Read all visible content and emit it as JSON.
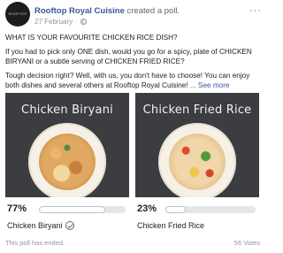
{
  "header": {
    "avatar_text": "ROOFTOP ROYAL",
    "page_name": "Rooftop Royal Cuisine",
    "action": "created a poll.",
    "date": "27 February"
  },
  "post": {
    "heading": "WHAT IS YOUR FAVOURITE CHICKEN RICE DISH?",
    "body": "If you had to pick only ONE dish, would you go for a spicy, plate of CHICKEN BIRYANI or a subtle serving of CHICKEN FRIED RICE?",
    "teaser": "Tough decision right? Well, with us, you don't have to choose! You can enjoy both dishes and several others at Rooftop Royal Cuisine!",
    "see_more": "... See more"
  },
  "poll": {
    "options": [
      {
        "image_title": "Chicken Biryani",
        "percent_label": "77%",
        "percent": 77,
        "label": "Chicken Biryani",
        "selected": true
      },
      {
        "image_title": "Chicken Fried Rice",
        "percent_label": "23%",
        "percent": 23,
        "label": "Chicken Fried Rice",
        "selected": false
      }
    ],
    "status": "This poll has ended.",
    "votes": "56 Votes"
  },
  "colors": {
    "link": "#385898",
    "muted": "#90949c",
    "photo_bg": "#3b3d40"
  },
  "icons": [
    "globe-icon",
    "more-options-icon",
    "check-icon"
  ]
}
